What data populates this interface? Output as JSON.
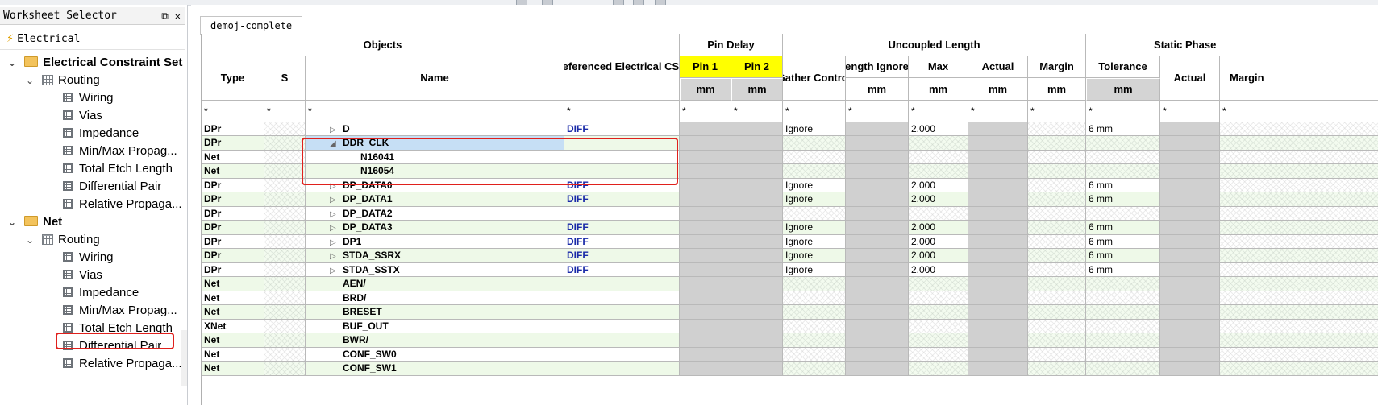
{
  "left_panel": {
    "title": "Worksheet Selector",
    "dock_symbol": "⧉",
    "close_symbol": "✕",
    "worksheet_label": "Electrical",
    "tree": [
      {
        "label": "Electrical Constraint Set",
        "level": 0,
        "type": "folder",
        "expanded": true,
        "bold": true
      },
      {
        "label": "Routing",
        "level": 1,
        "type": "routing",
        "expanded": true
      },
      {
        "label": "Wiring",
        "level": 2,
        "type": "sheet"
      },
      {
        "label": "Vias",
        "level": 2,
        "type": "sheet"
      },
      {
        "label": "Impedance",
        "level": 2,
        "type": "sheet"
      },
      {
        "label": "Min/Max Propag...",
        "level": 2,
        "type": "sheet"
      },
      {
        "label": "Total Etch Length",
        "level": 2,
        "type": "sheet"
      },
      {
        "label": "Differential Pair",
        "level": 2,
        "type": "sheet"
      },
      {
        "label": "Relative Propaga...",
        "level": 2,
        "type": "sheet"
      },
      {
        "label": "Net",
        "level": 0,
        "type": "folder",
        "expanded": true,
        "bold": true
      },
      {
        "label": "Routing",
        "level": 1,
        "type": "routing",
        "expanded": true
      },
      {
        "label": "Wiring",
        "level": 2,
        "type": "sheet"
      },
      {
        "label": "Vias",
        "level": 2,
        "type": "sheet"
      },
      {
        "label": "Impedance",
        "level": 2,
        "type": "sheet"
      },
      {
        "label": "Min/Max Propag...",
        "level": 2,
        "type": "sheet"
      },
      {
        "label": "Total Etch Length",
        "level": 2,
        "type": "sheet"
      },
      {
        "label": "Differential Pair",
        "level": 2,
        "type": "sheet",
        "highlighted": true
      },
      {
        "label": "Relative Propaga...",
        "level": 2,
        "type": "sheet"
      }
    ]
  },
  "tab": {
    "label": "demoj-complete"
  },
  "headers": {
    "objects": "Objects",
    "type": "Type",
    "s": "S",
    "name": "Name",
    "ref_cset": "Referenced Electrical CSet",
    "pin_delay": "Pin Delay",
    "pin1": "Pin 1",
    "pin2": "Pin 2",
    "uncoupled_length": "Uncoupled Length",
    "gather_control": "Gather Control",
    "length_ignored": "Length Ignored",
    "max": "Max",
    "actual": "Actual",
    "margin": "Margin",
    "static_phase": "Static Phase",
    "tolerance": "Tolerance",
    "sp_actual": "Actual",
    "sp_margin": "Margin",
    "unit": "mm",
    "filter": "*"
  },
  "rows": [
    {
      "type": "DPr",
      "name": "D",
      "expander": "collapsed",
      "indent": 0,
      "cset": "DIFF",
      "gather": "Ignore",
      "max": "2.000",
      "tolerance": "6 mm",
      "partial": true
    },
    {
      "type": "DPr",
      "name": "DDR_CLK",
      "expander": "expanded",
      "indent": 0,
      "cset": "",
      "gather": "",
      "max": "",
      "tolerance": "",
      "selected": true
    },
    {
      "type": "Net",
      "name": "N16041",
      "expander": "",
      "indent": 1,
      "cset": "",
      "gather": "",
      "max": "",
      "tolerance": ""
    },
    {
      "type": "Net",
      "name": "N16054",
      "expander": "",
      "indent": 1,
      "cset": "",
      "gather": "",
      "max": "",
      "tolerance": ""
    },
    {
      "type": "DPr",
      "name": "DP_DATA0",
      "expander": "collapsed",
      "indent": 0,
      "cset": "DIFF",
      "gather": "Ignore",
      "max": "2.000",
      "tolerance": "6 mm"
    },
    {
      "type": "DPr",
      "name": "DP_DATA1",
      "expander": "collapsed",
      "indent": 0,
      "cset": "DIFF",
      "gather": "Ignore",
      "max": "2.000",
      "tolerance": "6 mm"
    },
    {
      "type": "DPr",
      "name": "DP_DATA2",
      "expander": "collapsed",
      "indent": 0,
      "cset": "",
      "gather": "",
      "max": "",
      "tolerance": ""
    },
    {
      "type": "DPr",
      "name": "DP_DATA3",
      "expander": "collapsed",
      "indent": 0,
      "cset": "DIFF",
      "gather": "Ignore",
      "max": "2.000",
      "tolerance": "6 mm"
    },
    {
      "type": "DPr",
      "name": "DP1",
      "expander": "collapsed",
      "indent": 0,
      "cset": "DIFF",
      "gather": "Ignore",
      "max": "2.000",
      "tolerance": "6 mm"
    },
    {
      "type": "DPr",
      "name": "STDA_SSRX",
      "expander": "collapsed",
      "indent": 0,
      "cset": "DIFF",
      "gather": "Ignore",
      "max": "2.000",
      "tolerance": "6 mm"
    },
    {
      "type": "DPr",
      "name": "STDA_SSTX",
      "expander": "collapsed",
      "indent": 0,
      "cset": "DIFF",
      "gather": "Ignore",
      "max": "2.000",
      "tolerance": "6 mm"
    },
    {
      "type": "Net",
      "name": "AEN/",
      "expander": "",
      "indent": 0,
      "cset": "",
      "gather": "",
      "max": "",
      "tolerance": ""
    },
    {
      "type": "Net",
      "name": "BRD/",
      "expander": "",
      "indent": 0,
      "cset": "",
      "gather": "",
      "max": "",
      "tolerance": ""
    },
    {
      "type": "Net",
      "name": "BRESET",
      "expander": "",
      "indent": 0,
      "cset": "",
      "gather": "",
      "max": "",
      "tolerance": ""
    },
    {
      "type": "XNet",
      "name": "BUF_OUT",
      "expander": "",
      "indent": 0,
      "cset": "",
      "gather": "",
      "max": "",
      "tolerance": ""
    },
    {
      "type": "Net",
      "name": "BWR/",
      "expander": "",
      "indent": 0,
      "cset": "",
      "gather": "",
      "max": "",
      "tolerance": ""
    },
    {
      "type": "Net",
      "name": "CONF_SW0",
      "expander": "",
      "indent": 0,
      "cset": "",
      "gather": "",
      "max": "",
      "tolerance": ""
    },
    {
      "type": "Net",
      "name": "CONF_SW1",
      "expander": "",
      "indent": 0,
      "cset": "",
      "gather": "",
      "max": "",
      "tolerance": "",
      "partial": true
    }
  ],
  "colors": {
    "highlight_box": "#e0201c",
    "yellow_header": "#ffff00",
    "selection": "#c6dff5",
    "diff_text": "#1a2aa8"
  }
}
